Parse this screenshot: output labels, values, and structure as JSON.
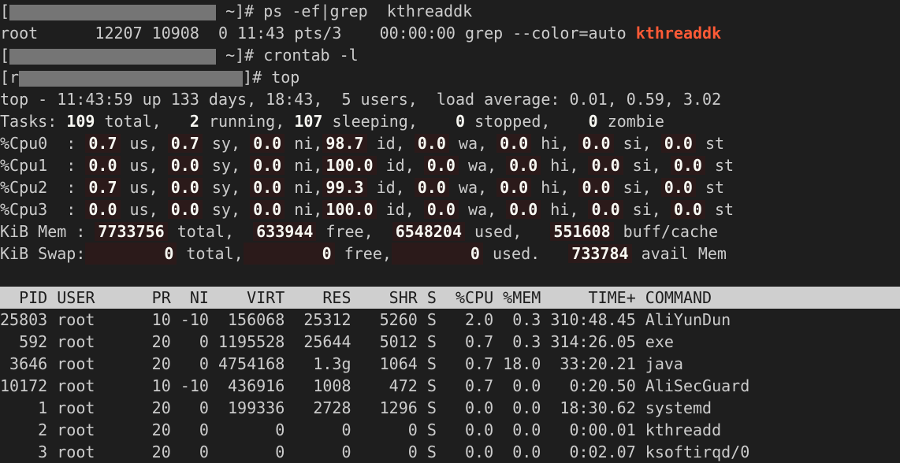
{
  "lines": [
    {
      "prefix": "[",
      "suffix": " ~]# ps -ef|grep  kthreaddk"
    },
    {
      "text": "root      12207 10908  0 11:43 pts/3    00:00:00 grep --color=auto ",
      "highlight": "kthreaddk"
    },
    {
      "prefix": "[",
      "suffix": " ~]# crontab -l"
    },
    {
      "prefix": "[r",
      "suffix": "]# top"
    },
    {
      "text": "top - 11:43:59 up 133 days, 18:43,  5 users,  load average: 0.01, 0.59, 3.02"
    }
  ],
  "tasks": {
    "label": "Tasks:",
    "total": "109",
    "total_l": "total,",
    "running": "2",
    "running_l": "running,",
    "sleeping": "107",
    "sleeping_l": "sleeping,",
    "stopped": "0",
    "stopped_l": "stopped,",
    "zombie": "0",
    "zombie_l": "zombie"
  },
  "cpus": [
    {
      "label": "%Cpu0  :",
      "us": "0.7",
      "sy": "0.7",
      "ni": "0.0",
      "id": "98.7",
      "wa": "0.0",
      "hi": "0.0",
      "si": "0.0",
      "st": "0.0"
    },
    {
      "label": "%Cpu1  :",
      "us": "0.0",
      "sy": "0.0",
      "ni": "0.0",
      "id": "100.0",
      "wa": "0.0",
      "hi": "0.0",
      "si": "0.0",
      "st": "0.0"
    },
    {
      "label": "%Cpu2  :",
      "us": "0.7",
      "sy": "0.0",
      "ni": "0.0",
      "id": "99.3",
      "wa": "0.0",
      "hi": "0.0",
      "si": "0.0",
      "st": "0.0"
    },
    {
      "label": "%Cpu3  :",
      "us": "0.0",
      "sy": "0.0",
      "ni": "0.0",
      "id": "100.0",
      "wa": "0.0",
      "hi": "0.0",
      "si": "0.0",
      "st": "0.0"
    }
  ],
  "mem": {
    "label": "KiB Mem :",
    "total": "7733756",
    "free": "633944",
    "used": "6548204",
    "buff": "551608",
    "t_l": " total,",
    "f_l": " free,",
    "u_l": " used,",
    "b_l": " buff/cache"
  },
  "swap": {
    "label": "KiB Swap:",
    "total": "0",
    "free": "0",
    "used": "0",
    "avail": "733784",
    "t_l": " total,",
    "f_l": " free,",
    "u_l": " used.",
    "a_l": " avail Mem"
  },
  "table": {
    "header": "  PID USER      PR  NI    VIRT    RES    SHR S  %CPU %MEM     TIME+ COMMAND",
    "rows": [
      "25803 root      10 -10  156068  25312   5260 S   2.0  0.3 310:48.45 AliYunDun",
      "  592 root      20   0 1195528  25644   5012 S   0.7  0.3 314:26.05 exe",
      " 3646 root      20   0 4754168   1.3g   1064 S   0.7 18.0  33:20.21 java",
      "10172 root      10 -10  436916   1008    472 S   0.7  0.0   0:20.50 AliSecGuard",
      "    1 root      20   0  199336   2728   1296 S   0.0  0.0  18:30.62 systemd",
      "    2 root      20   0       0      0      0 S   0.0  0.0   0:00.01 kthreadd",
      "    3 root      20   0       0      0      0 S   0.0  0.0   0:02.07 ksoftirqd/0"
    ]
  }
}
